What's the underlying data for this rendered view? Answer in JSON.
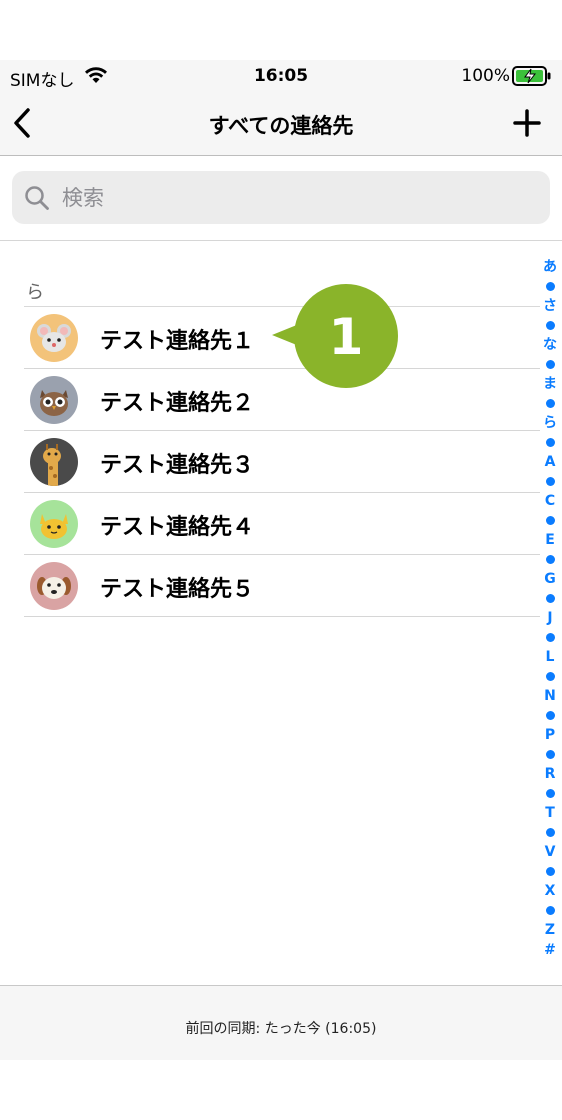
{
  "status": {
    "carrier": "SIMなし",
    "time": "16:05",
    "battery": "100%"
  },
  "nav": {
    "title": "すべての連絡先"
  },
  "search": {
    "placeholder": "検索"
  },
  "section": {
    "header": "ら"
  },
  "contacts": [
    {
      "name": "テスト連絡先１",
      "avatar": "mouse-icon",
      "bg": "#f3c37a"
    },
    {
      "name": "テスト連絡先２",
      "avatar": "owl-icon",
      "bg": "#9aa1ae"
    },
    {
      "name": "テスト連絡先３",
      "avatar": "giraffe-icon",
      "bg": "#4a4a4a"
    },
    {
      "name": "テスト連絡先４",
      "avatar": "cat-icon",
      "bg": "#a6e39a"
    },
    {
      "name": "テスト連絡先５",
      "avatar": "dog-icon",
      "bg": "#d9a3a3"
    }
  ],
  "index": [
    "あ",
    "•",
    "さ",
    "•",
    "な",
    "•",
    "ま",
    "•",
    "ら",
    "•",
    "A",
    "•",
    "C",
    "•",
    "E",
    "•",
    "G",
    "•",
    "J",
    "•",
    "L",
    "•",
    "N",
    "•",
    "P",
    "•",
    "R",
    "•",
    "T",
    "•",
    "V",
    "•",
    "X",
    "•",
    "Z",
    "#"
  ],
  "callout": {
    "number": "1",
    "color": "#8ab42a"
  },
  "footer": {
    "sync": "前回の同期: たった今 (16:05)"
  },
  "colors": {
    "accent": "#0a7cff",
    "battery": "#3cc13b"
  }
}
